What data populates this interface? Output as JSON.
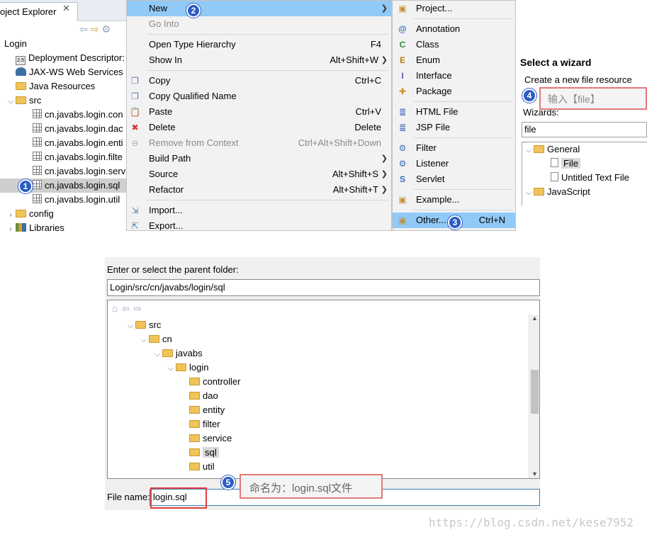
{
  "explorer": {
    "tab_label": "oject Explorer",
    "tree": [
      {
        "label": "Login",
        "indent": 0,
        "icon": "project-icon",
        "arrow": ""
      },
      {
        "label": "Deployment Descriptor: L",
        "indent": 1,
        "icon": "descriptor-icon",
        "arrow": ""
      },
      {
        "label": "JAX-WS Web Services",
        "indent": 1,
        "icon": "webservice-icon",
        "arrow": ""
      },
      {
        "label": "Java Resources",
        "indent": 1,
        "icon": "java-resources-icon",
        "arrow": ""
      },
      {
        "label": "src",
        "indent": 1,
        "icon": "folder-icon",
        "arrow": "expanded"
      },
      {
        "label": "cn.javabs.login.con",
        "indent": 2,
        "icon": "package-icon",
        "arrow": ""
      },
      {
        "label": "cn.javabs.login.dac",
        "indent": 2,
        "icon": "package-icon",
        "arrow": ""
      },
      {
        "label": "cn.javabs.login.enti",
        "indent": 2,
        "icon": "package-icon",
        "arrow": ""
      },
      {
        "label": "cn.javabs.login.filte",
        "indent": 2,
        "icon": "package-icon",
        "arrow": ""
      },
      {
        "label": "cn.javabs.login.serv",
        "indent": 2,
        "icon": "package-icon",
        "arrow": ""
      },
      {
        "label": "cn.javabs.login.sql",
        "indent": 2,
        "icon": "package-icon",
        "arrow": "",
        "selected": true
      },
      {
        "label": "cn.javabs.login.util",
        "indent": 2,
        "icon": "package-icon",
        "arrow": ""
      },
      {
        "label": "config",
        "indent": 1,
        "icon": "folder-icon",
        "arrow": "collapsed"
      },
      {
        "label": "Libraries",
        "indent": 1,
        "icon": "library-icon",
        "arrow": "collapsed"
      }
    ]
  },
  "context_menu": {
    "items": [
      {
        "label": "New",
        "shortcut": "",
        "submenu": true,
        "highlight": true
      },
      {
        "label": "Go Into",
        "shortcut": "",
        "disabled": true
      },
      {
        "sep": true
      },
      {
        "label": "Open Type Hierarchy",
        "shortcut": "F4"
      },
      {
        "label": "Show In",
        "shortcut": "Alt+Shift+W",
        "submenu": true
      },
      {
        "sep": true
      },
      {
        "label": "Copy",
        "shortcut": "Ctrl+C",
        "icon": "copy-icon"
      },
      {
        "label": "Copy Qualified Name",
        "shortcut": "",
        "icon": "copy-qualified-icon"
      },
      {
        "label": "Paste",
        "shortcut": "Ctrl+V",
        "icon": "paste-icon"
      },
      {
        "label": "Delete",
        "shortcut": "Delete",
        "icon": "delete-icon"
      },
      {
        "label": "Remove from Context",
        "shortcut": "Ctrl+Alt+Shift+Down",
        "disabled": true,
        "icon": "remove-context-icon"
      },
      {
        "label": "Build Path",
        "shortcut": "",
        "submenu": true
      },
      {
        "label": "Source",
        "shortcut": "Alt+Shift+S",
        "submenu": true
      },
      {
        "label": "Refactor",
        "shortcut": "Alt+Shift+T",
        "submenu": true
      },
      {
        "sep": true
      },
      {
        "label": "Import...",
        "shortcut": "",
        "icon": "import-icon"
      },
      {
        "label": "Export...",
        "shortcut": "",
        "icon": "export-icon"
      }
    ]
  },
  "new_submenu": {
    "items": [
      {
        "label": "Project...",
        "icon": "project-wizard-icon"
      },
      {
        "sep": true
      },
      {
        "label": "Annotation",
        "icon": "annotation-icon"
      },
      {
        "label": "Class",
        "icon": "class-icon"
      },
      {
        "label": "Enum",
        "icon": "enum-icon"
      },
      {
        "label": "Interface",
        "icon": "interface-icon"
      },
      {
        "label": "Package",
        "icon": "package-wizard-icon"
      },
      {
        "sep": true
      },
      {
        "label": "HTML File",
        "icon": "html-file-icon"
      },
      {
        "label": "JSP File",
        "icon": "jsp-file-icon"
      },
      {
        "sep": true
      },
      {
        "label": "Filter",
        "icon": "filter-icon"
      },
      {
        "label": "Listener",
        "icon": "listener-icon"
      },
      {
        "label": "Servlet",
        "icon": "servlet-icon"
      },
      {
        "sep": true
      },
      {
        "label": "Example...",
        "icon": "example-icon"
      },
      {
        "sep": true
      },
      {
        "label": "Other...",
        "shortcut": "Ctrl+N",
        "icon": "other-icon",
        "highlight": true
      }
    ]
  },
  "wizard": {
    "title": "Select a wizard",
    "subtitle": "Create a new file resource",
    "hint": "输入【file】",
    "wizards_label": "Wizards:",
    "filter_value": "file",
    "tree": [
      {
        "label": "General",
        "indent": 0,
        "arrow": "expanded",
        "icon": "folder-icon"
      },
      {
        "label": "File",
        "indent": 1,
        "arrow": "",
        "icon": "file-icon",
        "selected": true
      },
      {
        "label": "Untitled Text File",
        "indent": 1,
        "arrow": "",
        "icon": "text-file-icon"
      },
      {
        "label": "JavaScript",
        "indent": 0,
        "arrow": "expanded",
        "icon": "folder-icon"
      }
    ]
  },
  "dialog": {
    "parent_label": "Enter or select the parent folder:",
    "parent_value": "Login/src/cn/javabs/login/sql",
    "tree": [
      {
        "label": "src",
        "indent": 1,
        "arrow": "expanded"
      },
      {
        "label": "cn",
        "indent": 2,
        "arrow": "expanded"
      },
      {
        "label": "javabs",
        "indent": 3,
        "arrow": "expanded"
      },
      {
        "label": "login",
        "indent": 4,
        "arrow": "expanded"
      },
      {
        "label": "controller",
        "indent": 5,
        "arrow": ""
      },
      {
        "label": "dao",
        "indent": 5,
        "arrow": ""
      },
      {
        "label": "entity",
        "indent": 5,
        "arrow": ""
      },
      {
        "label": "filter",
        "indent": 5,
        "arrow": ""
      },
      {
        "label": "service",
        "indent": 5,
        "arrow": ""
      },
      {
        "label": "sql",
        "indent": 5,
        "arrow": "",
        "selected": true
      },
      {
        "label": "util",
        "indent": 5,
        "arrow": ""
      }
    ],
    "file_name_label": "File name:",
    "file_name_value": "login.sql"
  },
  "annotations": {
    "badges": [
      "1",
      "2",
      "3",
      "4",
      "5"
    ],
    "note5": "命名为：login.sql文件"
  },
  "watermark": "https://blog.csdn.net/kese7952",
  "colors": {
    "menu_highlight": "#91c9f7",
    "badge": "#2b5cc4",
    "red_box": "#e34040",
    "selection": "#cfcfcf"
  }
}
